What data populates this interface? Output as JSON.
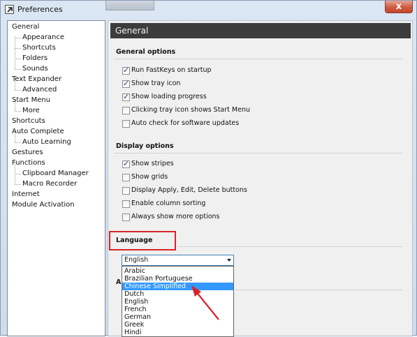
{
  "window": {
    "title": "Preferences",
    "close_symbol": "x"
  },
  "sidebar": {
    "items": [
      {
        "label": "General",
        "level": 0
      },
      {
        "label": "Appearance",
        "level": 1
      },
      {
        "label": "Shortcuts",
        "level": 1
      },
      {
        "label": "Folders",
        "level": 1
      },
      {
        "label": "Sounds",
        "level": 1
      },
      {
        "label": "Text Expander",
        "level": 0
      },
      {
        "label": "Advanced",
        "level": 1
      },
      {
        "label": "Start Menu",
        "level": 0
      },
      {
        "label": "More",
        "level": 1
      },
      {
        "label": "Shortcuts",
        "level": 0
      },
      {
        "label": "Auto Complete",
        "level": 0
      },
      {
        "label": "Auto Learning",
        "level": 1
      },
      {
        "label": "Gestures",
        "level": 0
      },
      {
        "label": "Functions",
        "level": 0
      },
      {
        "label": "Clipboard Manager",
        "level": 1
      },
      {
        "label": "Macro Recorder",
        "level": 1
      },
      {
        "label": "Internet",
        "level": 0
      },
      {
        "label": "Module Activation",
        "level": 0
      }
    ]
  },
  "main": {
    "header": "General",
    "general_options": {
      "title": "General options",
      "items": [
        {
          "label": "Run FastKeys on startup",
          "checked": true
        },
        {
          "label": "Show tray icon",
          "checked": true
        },
        {
          "label": "Show loading progress",
          "checked": true
        },
        {
          "label": "Clicking tray icon shows Start Menu",
          "checked": false
        },
        {
          "label": "Auto check for software updates",
          "checked": false
        }
      ]
    },
    "display_options": {
      "title": "Display options",
      "items": [
        {
          "label": "Show stripes",
          "checked": true
        },
        {
          "label": "Show grids",
          "checked": false
        },
        {
          "label": "Display Apply, Edit, Delete buttons",
          "checked": false
        },
        {
          "label": "Enable column sorting",
          "checked": false
        },
        {
          "label": "Always show more options",
          "checked": false
        }
      ]
    },
    "language": {
      "title": "Language",
      "selected": "English",
      "options": [
        "Arabic",
        "Brazilian Portuguese",
        "Chinese Simplified",
        "Dutch",
        "English",
        "French",
        "German",
        "Greek",
        "Hindi"
      ],
      "highlighted": "Chinese Simplified"
    },
    "next_section_peek": "A"
  },
  "colors": {
    "header_bg": "#3c3c3c",
    "selection": "#3399ff",
    "annotation": "#d8232a"
  }
}
